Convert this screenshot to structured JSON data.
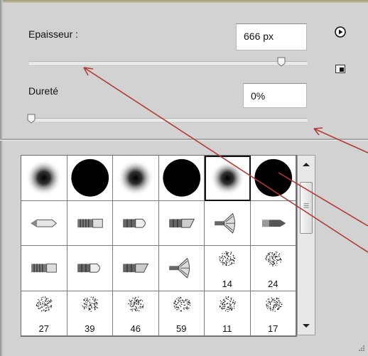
{
  "size": {
    "label": "Epaisseur :",
    "value": "666 px",
    "level_fraction": 0.92
  },
  "hardness": {
    "label": "Dureté",
    "value": "0%",
    "level_fraction": 0.0
  },
  "icons": {
    "play": "play-circle-icon",
    "panel_menu": "panel-menu-icon",
    "scroll_up": "scroll-up-arrow-icon",
    "scroll_down": "scroll-down-arrow-icon",
    "grip": "resize-grip-icon"
  },
  "brushes": [
    {
      "kind": "soft-round",
      "label": ""
    },
    {
      "kind": "hard-round",
      "label": ""
    },
    {
      "kind": "soft-round",
      "label": ""
    },
    {
      "kind": "hard-round",
      "label": ""
    },
    {
      "kind": "soft-round",
      "label": "",
      "selected": true
    },
    {
      "kind": "hard-round",
      "label": ""
    },
    {
      "kind": "pencil-tip",
      "label": ""
    },
    {
      "kind": "flat-bristle",
      "label": ""
    },
    {
      "kind": "round-bristle",
      "label": ""
    },
    {
      "kind": "angled-bristle",
      "label": ""
    },
    {
      "kind": "fan-bristle",
      "label": ""
    },
    {
      "kind": "marker-tip",
      "label": ""
    },
    {
      "kind": "flat-bristle",
      "label": ""
    },
    {
      "kind": "round-bristle",
      "label": ""
    },
    {
      "kind": "angled-bristle",
      "label": ""
    },
    {
      "kind": "fan-bristle",
      "label": ""
    },
    {
      "kind": "scatter",
      "label": "14"
    },
    {
      "kind": "scatter",
      "label": "24"
    },
    {
      "kind": "scatter",
      "label": "27"
    },
    {
      "kind": "scatter",
      "label": "39"
    },
    {
      "kind": "scatter",
      "label": "46"
    },
    {
      "kind": "scatter",
      "label": "59"
    },
    {
      "kind": "scatter",
      "label": "11"
    },
    {
      "kind": "scatter",
      "label": "17"
    }
  ],
  "colors": {
    "annotation": "#b33a35",
    "panel": "#d2d2d2"
  }
}
